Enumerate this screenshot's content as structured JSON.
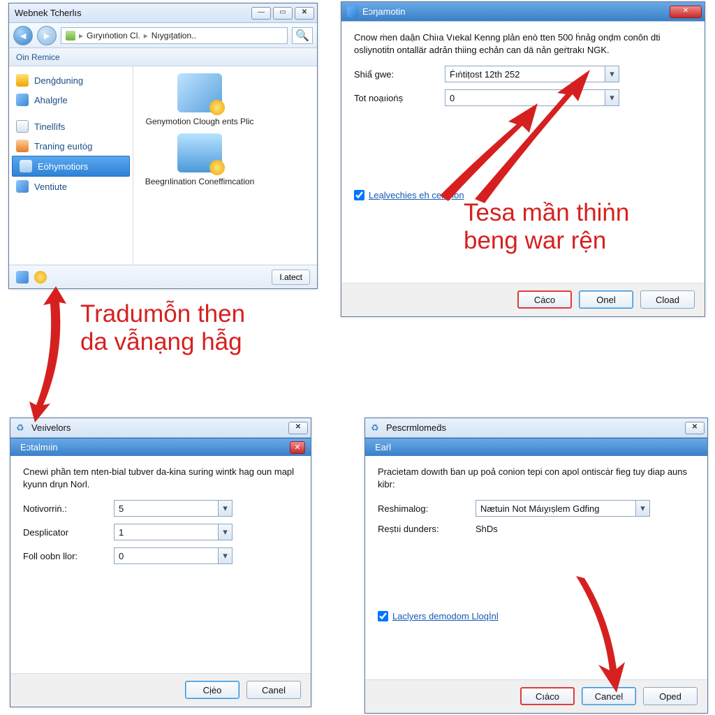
{
  "explorer": {
    "title": "Webnek Tcherlıs",
    "crumb1": "Gıryıṅotion Cl.",
    "crumb2": "Nıygıṯation..",
    "orgbar": "Oin Remice",
    "sidebar": {
      "items": [
        {
          "label": "Denģduning"
        },
        {
          "label": "Ahalgrle"
        },
        {
          "label": "Tinellïfs"
        },
        {
          "label": "Traning euıtȯg"
        },
        {
          "label": "Eȯhymotiors"
        },
        {
          "label": "Ventiute"
        }
      ]
    },
    "files": [
      {
        "label": "Genymotion Clough ents Plic"
      },
      {
        "label": "Beegrılination Coneffimcation"
      }
    ],
    "status_btn": "I.atect"
  },
  "dlg_tr": {
    "title": "Eɔŋamotin",
    "desc": "Cnow ṁen daận Chiıa Vıekal Kenng plản enò tten 500 ḣnảg onḍm conôn dti osliynotiṫn ontallär adrản thiing echản can dä nản geṙtrakı NGK.",
    "f1_label": "Shiẩ gwe:",
    "f1_value": "Ḟıṅtiṭost 12th 252",
    "f2_label": "Tot noạıioṅṣ",
    "f2_value": "0",
    "chk": "Leạlvechies eh cenṃȯn",
    "b1": "Cȧco",
    "b2": "Onel",
    "b3": "Cload"
  },
  "dlg_bl": {
    "title": "Veıivelors",
    "inner_title": "Eɔtalmıin",
    "desc": "Cnewi phần tem nten-bial tubver da-kina suring wintk hag oun mapl kyunn drụn Noɾl.",
    "f1": "Notivorriṅ.:",
    "v1": "5",
    "f2": "Desplicator",
    "v2": "1",
    "f3": "Foll oobn llor:",
    "v3": "0",
    "b1": "Cịėo",
    "b2": "Canel"
  },
  "dlg_br": {
    "title": "Pescrmlomeḋs",
    "inner_title": "Eaṙl",
    "desc": "Pracietam dowıth ḃan up poả conion tepi con apol ontiscȧr fieg tuy diap auns kibr:",
    "f1": "Reshimalog:",
    "v1": "Nætuin Not Máıỵıṣlem Gdfing",
    "f2": "Reṣtıi dunders:",
    "v2": "ShDs",
    "chk": "Laclyers demodom Lloqİnl",
    "b1": "Cıȧco",
    "b2": "Cancel",
    "b3": "Oped"
  },
  "ann1": "Tradumỗn then\nda vẫnạng hẫg",
  "ann2": "Tesa mần thiṅn\nbeng war rện"
}
